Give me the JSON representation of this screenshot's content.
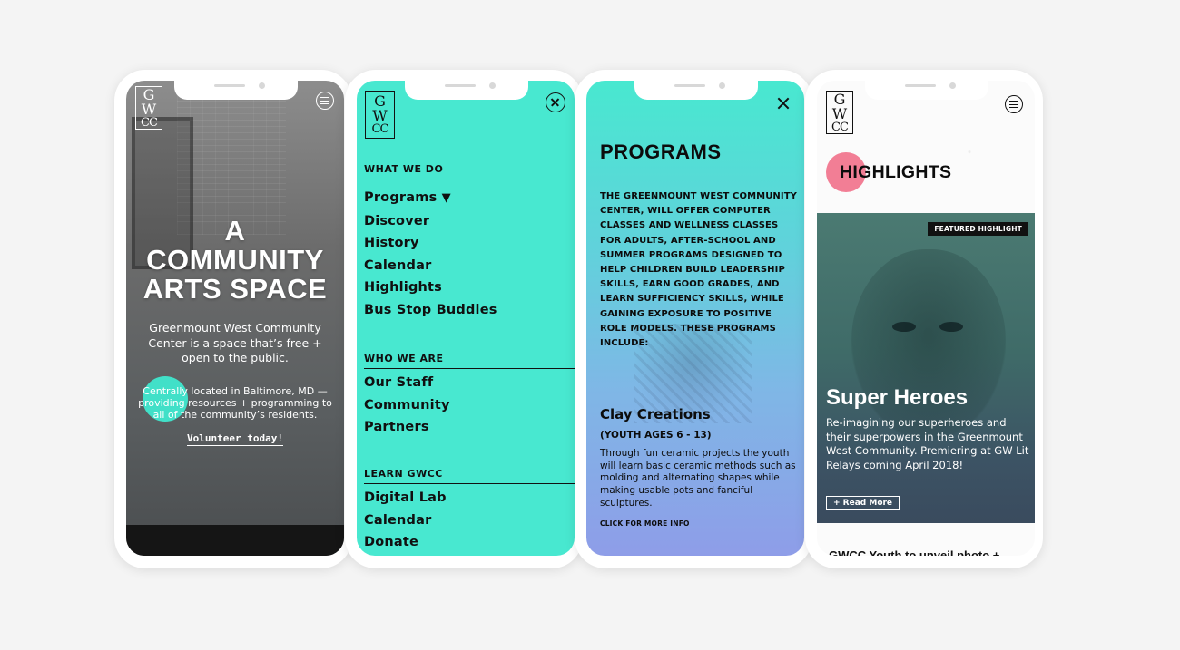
{
  "brand": {
    "logo_line1": "G",
    "logo_line2": "W",
    "logo_line3": "CC"
  },
  "colors": {
    "mint": "#48e8d0",
    "teal_blob": "#41e0c8",
    "pink": "#f27e95",
    "purple": "#8e9de8"
  },
  "icons": {
    "menu": "menu-icon",
    "close": "close-icon",
    "triangle": "triangle-down-icon"
  },
  "home": {
    "headline_line1": "A",
    "headline_line2": "COMMUNITY",
    "headline_line3": "ARTS SPACE",
    "subtitle": "Greenmount West Community Center is a space that’s free + open to the public.",
    "location": "Centrally located in Baltimore, MD — providing resources + programming to all of the community’s residents.",
    "cta": "Volunteer today!"
  },
  "menu": {
    "sections": [
      {
        "heading": "WHAT WE DO",
        "items": [
          "Programs",
          "Discover",
          "History",
          "Calendar",
          "Highlights",
          "Bus Stop Buddies"
        ]
      },
      {
        "heading": "WHO WE ARE",
        "items": [
          "Our Staff",
          "Community",
          "Partners"
        ]
      },
      {
        "heading": "LEARN GWCC",
        "items": [
          "Digital Lab",
          "Calendar",
          "Donate"
        ]
      }
    ],
    "programs_arrow": "▼"
  },
  "programs": {
    "title": "PROGRAMS",
    "intro": "THE GREENMOUNT WEST COMMUNITY CENTER, WILL OFFER COMPUTER CLASSES AND WELLNESS CLASSES FOR ADULTS, AFTER-SCHOOL AND SUMMER PROGRAMS DESIGNED TO HELP CHILDREN BUILD LEADERSHIP SKILLS, EARN GOOD GRADES, AND LEARN SUFFICIENCY SKILLS, WHILE GAINING EXPOSURE TO POSITIVE ROLE MODELS. THESE PROGRAMS INCLUDE:",
    "program_title": "Clay Creations",
    "program_ages": "(YOUTH AGES 6 - 13)",
    "program_desc": "Through fun ceramic projects the youth will learn basic ceramic methods such as molding and alternating shapes while making usable pots and fanciful sculptures.",
    "more_link": "CLICK FOR MORE INFO"
  },
  "highlights": {
    "title": "HIGHLIGHTS",
    "badge": "FEATURED HIGHLIGHT",
    "card_title": "Super Heroes",
    "card_desc": "Re-imagining our superheroes and their superpowers in the Greenmount West Community. Premiering at GW Lit Relays coming April 2018!",
    "card_button": "+ Read More",
    "next_title": "GWCC Youth to unveil photo +"
  }
}
